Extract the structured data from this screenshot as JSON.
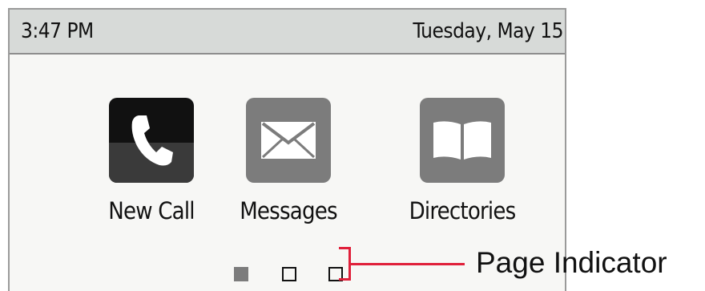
{
  "status_bar": {
    "time": "3:47 PM",
    "date": "Tuesday, May 15"
  },
  "apps": [
    {
      "label": "New Call",
      "icon": "phone-handset-icon"
    },
    {
      "label": "Messages",
      "icon": "envelope-icon"
    },
    {
      "label": "Directories",
      "icon": "open-book-icon"
    }
  ],
  "page_indicator": {
    "current_page": 1,
    "total_pages": 3
  },
  "callout": {
    "label": "Page Indicator",
    "color": "#e0203a"
  }
}
